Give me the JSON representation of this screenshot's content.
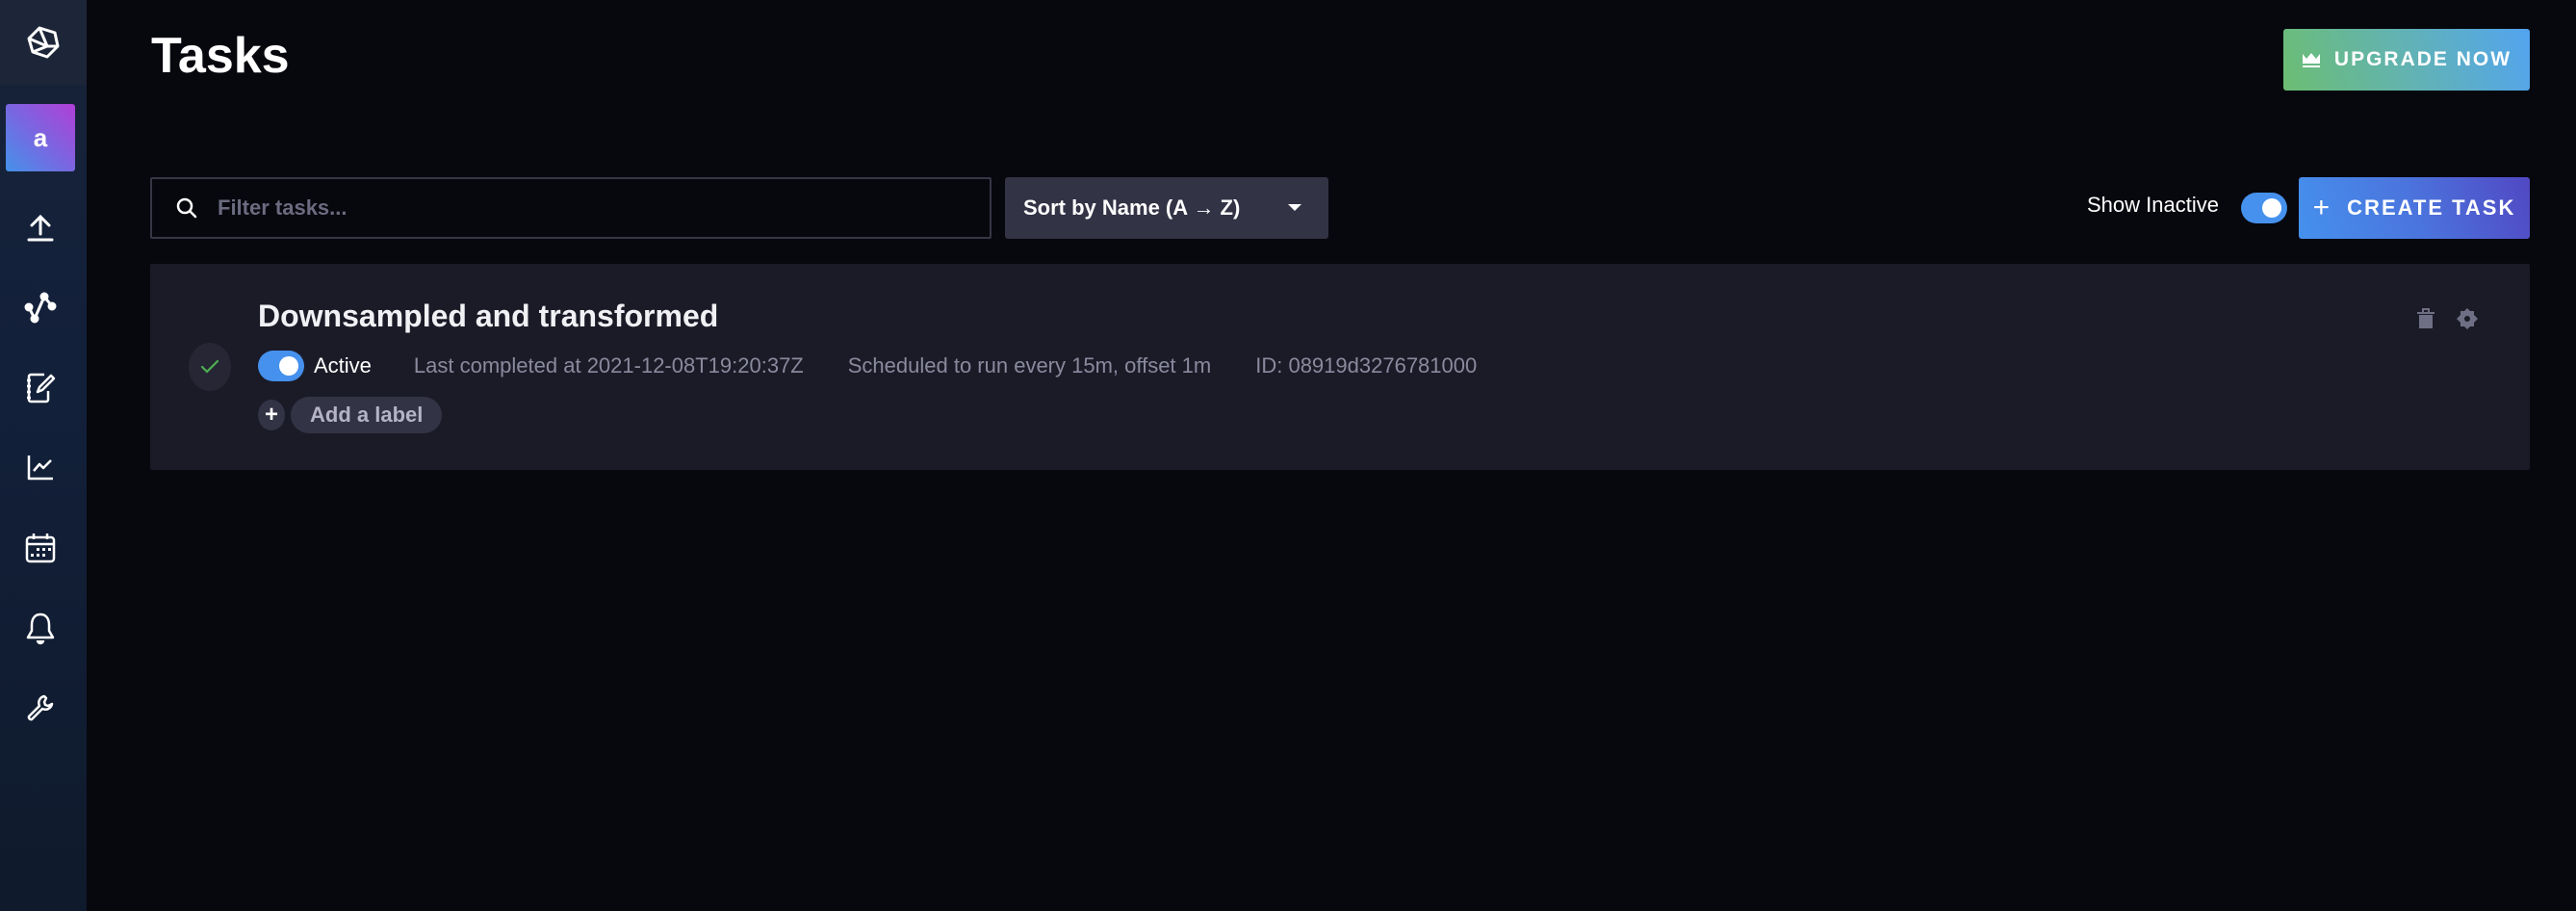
{
  "sidebar": {
    "logo": "influx-logo-icon",
    "org_initial": "a",
    "items": [
      {
        "name": "load-data",
        "icon": "upload-icon"
      },
      {
        "name": "data-explorer",
        "icon": "graph-icon"
      },
      {
        "name": "notebooks",
        "icon": "notebook-icon"
      },
      {
        "name": "dashboards",
        "icon": "chart-icon"
      },
      {
        "name": "tasks",
        "icon": "calendar-icon"
      },
      {
        "name": "alerts",
        "icon": "bell-icon"
      },
      {
        "name": "settings",
        "icon": "wrench-icon"
      }
    ]
  },
  "header": {
    "title": "Tasks",
    "upgrade_label": "UPGRADE NOW"
  },
  "toolbar": {
    "search_placeholder": "Filter tasks...",
    "search_value": "",
    "sort_label": "Sort by Name (A → Z)",
    "show_inactive_label": "Show Inactive",
    "show_inactive_on": true,
    "create_label": "CREATE TASK"
  },
  "tasks": [
    {
      "name": "Downsampled and transformed",
      "status": "success",
      "active": true,
      "active_label": "Active",
      "last_completed": "Last completed at 2021-12-08T19:20:37Z",
      "schedule": "Scheduled to run every 15m, offset 1m",
      "id": "ID: 08919d3276781000",
      "add_label": "Add a label"
    }
  ],
  "colors": {
    "accent_blue": "#4591ed",
    "success_green": "#4caf50",
    "card_bg": "#1b1b28",
    "page_bg": "#07070e"
  }
}
